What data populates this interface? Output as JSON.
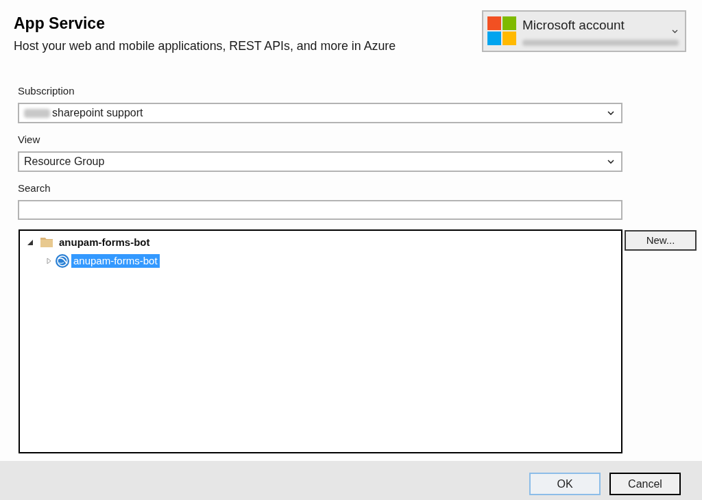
{
  "header": {
    "title": "App Service",
    "subtitle": "Host your web and mobile applications, REST APIs, and more in Azure"
  },
  "account": {
    "label": "Microsoft account",
    "email_blurred": true
  },
  "fields": [
    {
      "kind": "dropdown",
      "label": "Subscription",
      "value": "sharepoint support",
      "value_prefix_blurred": true
    },
    {
      "kind": "dropdown",
      "label": "View",
      "value": "Resource Group",
      "value_prefix_blurred": false
    },
    {
      "kind": "text",
      "label": "Search"
    }
  ],
  "tree": {
    "items": [
      {
        "label": "anupam-forms-bot",
        "kind": "resource-group",
        "expanded": true,
        "selected": false,
        "children": [
          {
            "label": "anupam-forms-bot",
            "kind": "app-service",
            "expanded": false,
            "selected": true
          }
        ]
      }
    ]
  },
  "new_button": {
    "label": "New..."
  },
  "footer": {
    "buttons": [
      {
        "label": "OK",
        "hovered": true,
        "focused": false
      },
      {
        "label": "Cancel",
        "hovered": false,
        "focused": true
      }
    ]
  }
}
